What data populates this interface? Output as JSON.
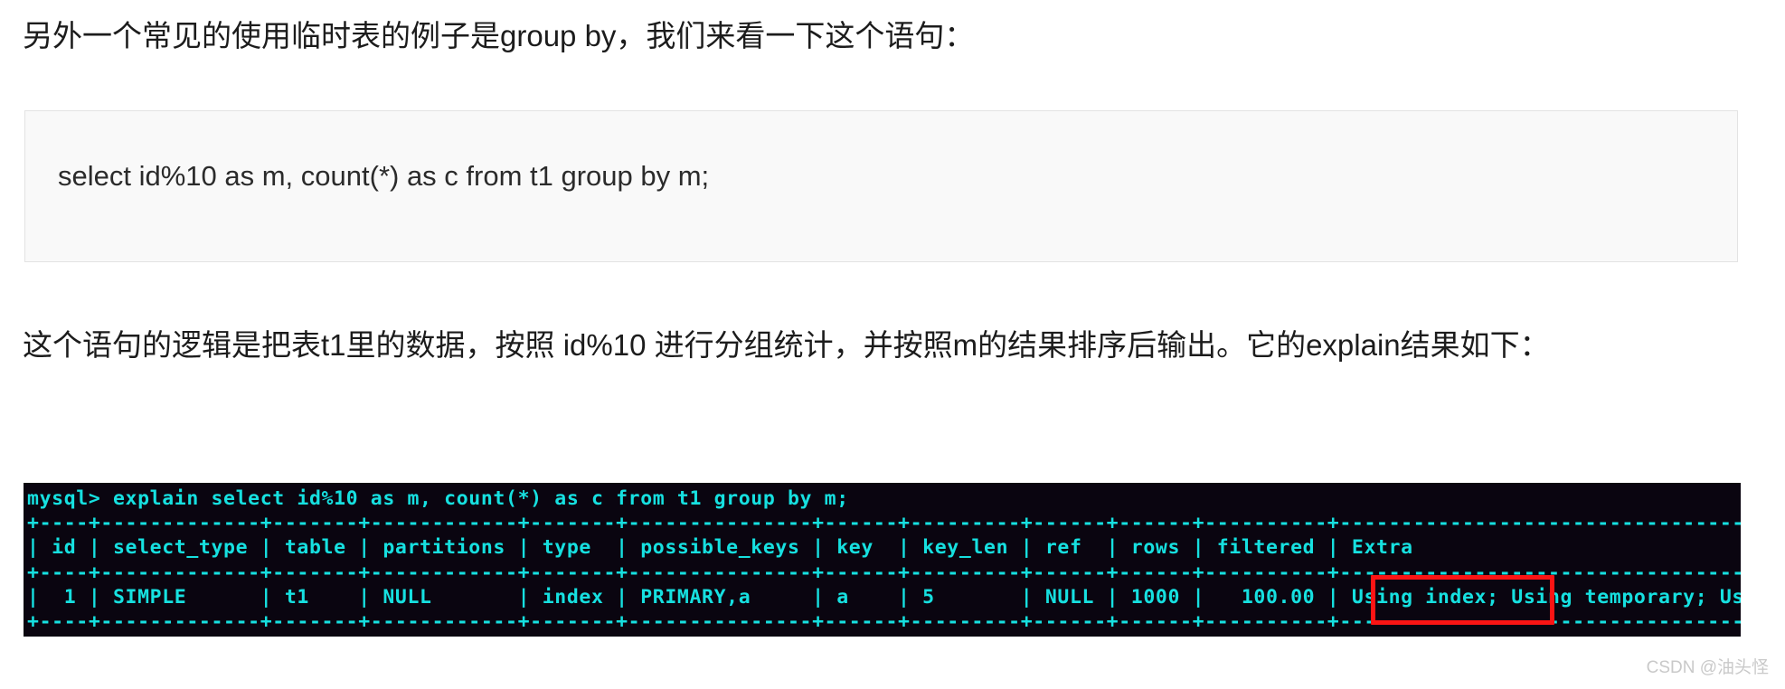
{
  "article": {
    "intro_paragraph": "另外一个常见的使用临时表的例子是group by，我们来看一下这个语句：",
    "explain_paragraph": "这个语句的逻辑是把表t1里的数据，按照 id%10 进行分组统计，并按照m的结果排序后输出。它的explain结果如下："
  },
  "sql_code_block": {
    "code": "select id%10 as m, count(*) as c from t1 group by m;"
  },
  "terminal": {
    "prompt": "mysql> ",
    "command": "explain select id%10 as m, count(*) as c from t1 group by m;",
    "output": "mysql> explain select id%10 as m, count(*) as c from t1 group by m;\n+----+-------------+-------+------------+-------+---------------+------+---------+------+------+----------+---------------------------------------------+\n| id | select_type | table | partitions | type  | possible_keys | key  | key_len | ref  | rows | filtered | Extra                                       |\n+----+-------------+-------+------------+-------+---------------+------+---------+------+------+----------+---------------------------------------------+\n|  1 | SIMPLE      | t1    | NULL       | index | PRIMARY,a     | a    | 5       | NULL | 1000 |   100.00 | Using index; Using temporary; Using filesort |\n+----+-------------+-------+------------+-------+---------------+------+---------+------+------+----------+---------------------------------------------+",
    "colors": {
      "text": "#16e0e0",
      "background": "#0a0510"
    },
    "table": {
      "headers": [
        "id",
        "select_type",
        "table",
        "partitions",
        "type",
        "possible_keys",
        "key",
        "key_len",
        "ref",
        "rows",
        "filtered",
        "Extra"
      ],
      "rows": [
        [
          "1",
          "SIMPLE",
          "t1",
          "NULL",
          "index",
          "PRIMARY,a",
          "a",
          "5",
          "NULL",
          "1000",
          "100.00",
          "Using index; Using temporary; Using filesort"
        ]
      ]
    }
  },
  "annotation": {
    "highlight_text": "Using temporary;",
    "highlight_color": "#fb1414"
  },
  "watermark": {
    "text": "CSDN @油头怪"
  }
}
